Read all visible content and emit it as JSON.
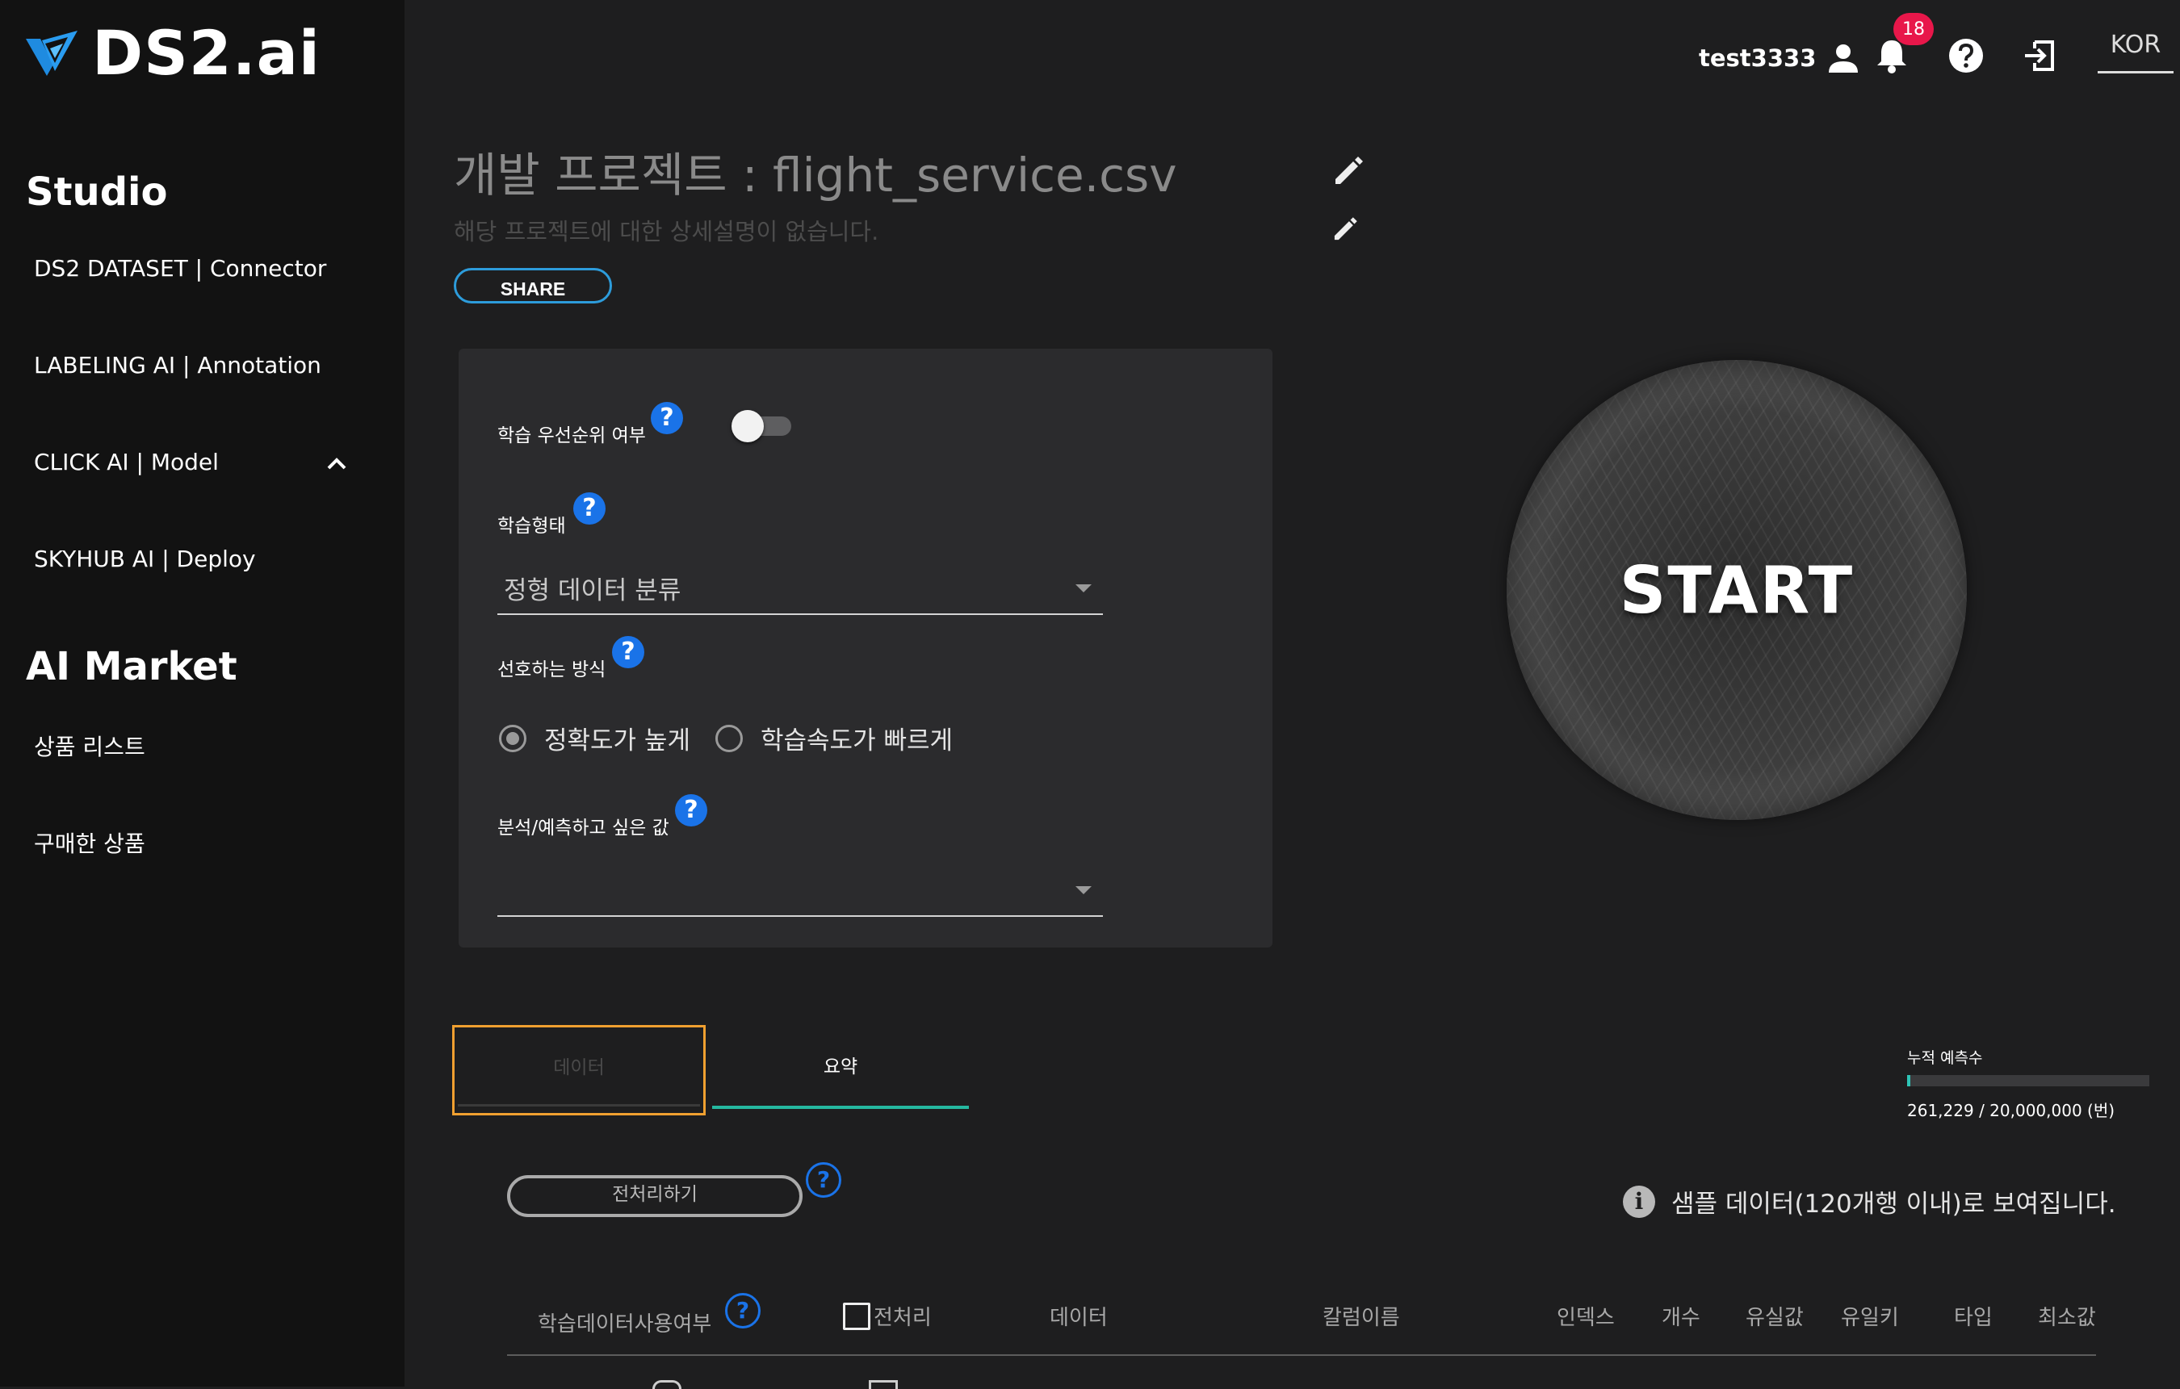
{
  "brand": {
    "name": "DS2.ai"
  },
  "sidebar": {
    "sections": [
      {
        "title": "Studio",
        "items": [
          {
            "label": "DS2 DATASET | Connector"
          },
          {
            "label": "LABELING AI | Annotation"
          },
          {
            "label": "CLICK AI | Model",
            "icon": "chevron-up-icon"
          },
          {
            "label": "SKYHUB AI | Deploy"
          }
        ]
      },
      {
        "title": "AI Market",
        "items": [
          {
            "label": "상품 리스트"
          },
          {
            "label": "구매한 상품"
          }
        ]
      }
    ]
  },
  "topbar": {
    "username": "test3333",
    "notification_count": "18",
    "language": "KOR",
    "icons": [
      "user-icon",
      "bell-icon",
      "help-icon",
      "logout-icon"
    ]
  },
  "project": {
    "title": "개발 프로젝트 : flight_service.csv",
    "description": "해당 프로젝트에 대한 상세설명이 없습니다.",
    "share_label": "SHARE"
  },
  "settings": {
    "priority_label": "학습 우선순위 여부",
    "priority_enabled": false,
    "training_type_label": "학습형태",
    "training_type_value": "정형 데이터 분류",
    "preference_label": "선호하는 방식",
    "preference_options": [
      "정확도가 높게",
      "학습속도가 빠르게"
    ],
    "preference_selected": "정확도가 높게",
    "target_label": "분석/예측하고 싶은 값",
    "target_value": "",
    "help_glyph": "?"
  },
  "start_button": {
    "label": "START"
  },
  "tabs": [
    {
      "label": "데이터",
      "active": false
    },
    {
      "label": "요약",
      "active": true
    }
  ],
  "prediction": {
    "label": "누적 예측수",
    "used": 261229,
    "limit": 20000000,
    "fraction": 0.013,
    "text": "261,229 / 20,000,000 (번)"
  },
  "preprocess": {
    "button_label": "전처리하기",
    "sample_notice": "샘플 데이터(120개행 이내)로 보여집니다.",
    "info_glyph": "i"
  },
  "table": {
    "columns": [
      "학습데이터사용여부",
      "전처리",
      "데이터",
      "칼럼이름",
      "인덱스",
      "개수",
      "유실값",
      "유일키",
      "타입",
      "최소값"
    ]
  },
  "colors": {
    "accent_blue": "#1a73e8",
    "share_border": "#2d9cdb",
    "tab_active": "#25b8a0",
    "badge": "#e8174a",
    "focus_outline": "#f0a030",
    "progress": "#2ec4b6"
  }
}
